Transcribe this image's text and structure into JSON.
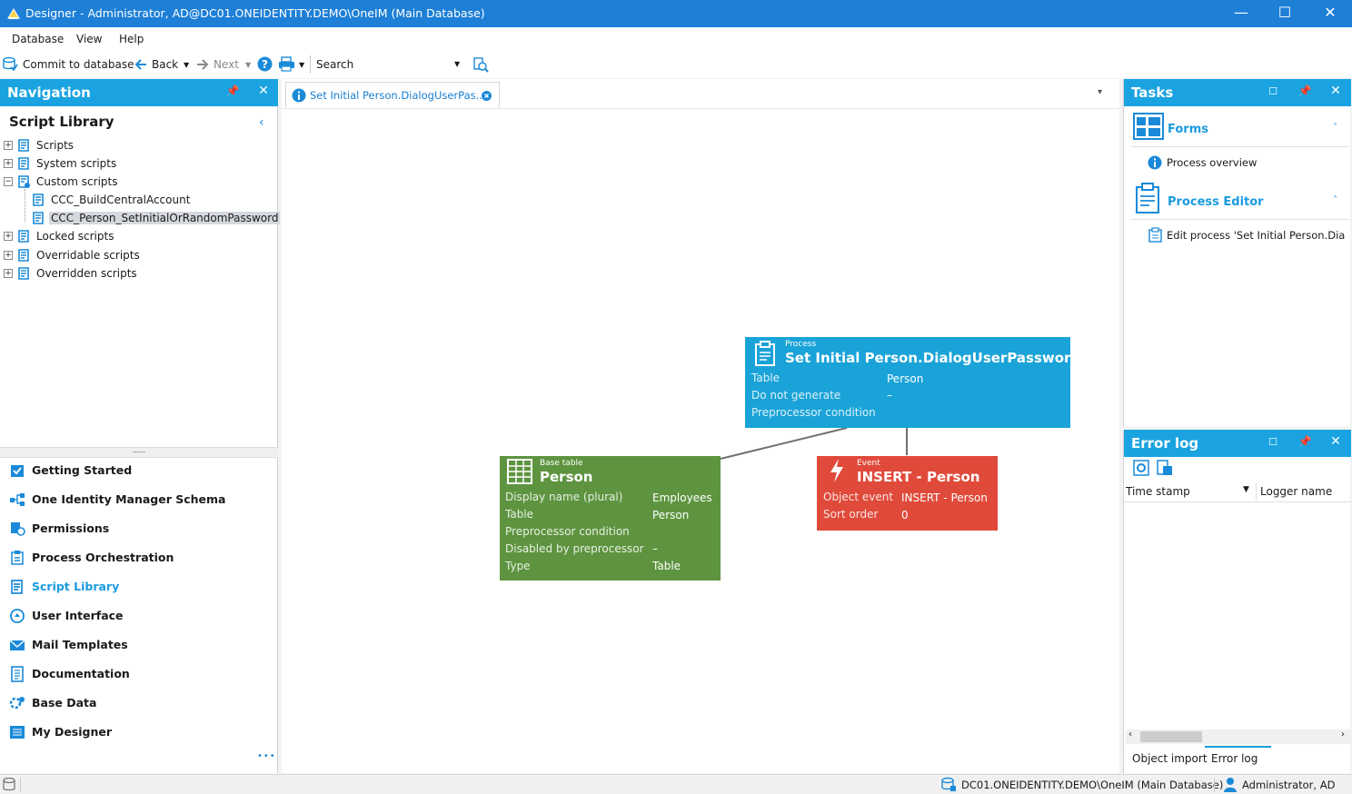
{
  "window": {
    "title": "Designer - Administrator, AD@DC01.ONEIDENTITY.DEMO\\OneIM (Main Database)",
    "controls": {
      "minimize": "—",
      "maximize": "☐",
      "close": "✕"
    }
  },
  "menu": {
    "items": [
      "Database",
      "View",
      "Help"
    ]
  },
  "toolbar": {
    "commit": "Commit to database",
    "back": "Back",
    "next": "Next",
    "search_label": "Search"
  },
  "navigation": {
    "title": "Navigation",
    "section_title": "Script Library",
    "collapse_glyph": "‹",
    "tree": [
      {
        "label": "Scripts",
        "expander": "+"
      },
      {
        "label": "System scripts",
        "expander": "+"
      },
      {
        "label": "Custom scripts",
        "expander": "−"
      },
      {
        "label": "CCC_BuildCentralAccount",
        "expander": ""
      },
      {
        "label": "CCC_Person_SetInitialOrRandomPassword",
        "expander": "",
        "selected": true
      },
      {
        "label": "Locked scripts",
        "expander": "+"
      },
      {
        "label": "Overridable scripts",
        "expander": "+"
      },
      {
        "label": "Overridden scripts",
        "expander": "+"
      }
    ],
    "items": [
      {
        "label": "Getting Started",
        "icon": "checklist-icon"
      },
      {
        "label": "One Identity Manager Schema",
        "icon": "schema-icon"
      },
      {
        "label": "Permissions",
        "icon": "permissions-icon"
      },
      {
        "label": "Process Orchestration",
        "icon": "process-icon"
      },
      {
        "label": "Script Library",
        "icon": "script-icon",
        "active": true
      },
      {
        "label": "User Interface",
        "icon": "ui-icon"
      },
      {
        "label": "Mail Templates",
        "icon": "mail-icon"
      },
      {
        "label": "Documentation",
        "icon": "documentation-icon"
      },
      {
        "label": "Base Data",
        "icon": "base-data-icon"
      },
      {
        "label": "My Designer",
        "icon": "my-designer-icon"
      }
    ],
    "more": "•••"
  },
  "editor": {
    "tab_title": "Set Initial Person.DialogUserPas...",
    "tab_dropdown": "▾"
  },
  "cards": {
    "process": {
      "kind": "Process",
      "name": "Set Initial Person.DialogUserPassword",
      "color": "#1aa3d8",
      "props": [
        {
          "label": "Table",
          "value": "Person"
        },
        {
          "label": "Do not generate",
          "value": "–"
        },
        {
          "label": "Preprocessor condition",
          "value": ""
        }
      ]
    },
    "base_table": {
      "kind": "Base table",
      "name": "Person",
      "color": "#5e9440",
      "props": [
        {
          "label": "Display name (plural)",
          "value": "Employees"
        },
        {
          "label": "Table",
          "value": "Person"
        },
        {
          "label": "Preprocessor condition",
          "value": ""
        },
        {
          "label": "Disabled by preprocessor",
          "value": "–"
        },
        {
          "label": "Type",
          "value": "Table"
        }
      ]
    },
    "event": {
      "kind": "Event",
      "name": "INSERT - Person",
      "color": "#e04a3a",
      "props": [
        {
          "label": "Object event",
          "value": "INSERT - Person"
        },
        {
          "label": "Sort order",
          "value": "0"
        }
      ]
    }
  },
  "tasks": {
    "title": "Tasks",
    "groups": [
      {
        "title": "Forms",
        "item": "Process overview"
      },
      {
        "title": "Process Editor",
        "item": "Edit process 'Set Initial Person.Dialo..."
      }
    ]
  },
  "error_log": {
    "title": "Error log",
    "columns": [
      "Time stamp",
      "Logger name"
    ],
    "tabs": [
      "Object import",
      "Error log"
    ]
  },
  "statusbar": {
    "connection": "DC01.ONEIDENTITY.DEMO\\OneIM (Main Database)",
    "user": "Administrator, AD"
  },
  "colors": {
    "titlebar": "#1e7fd6",
    "panel_header": "#1aa3e0",
    "accent": "#1a9be0"
  }
}
